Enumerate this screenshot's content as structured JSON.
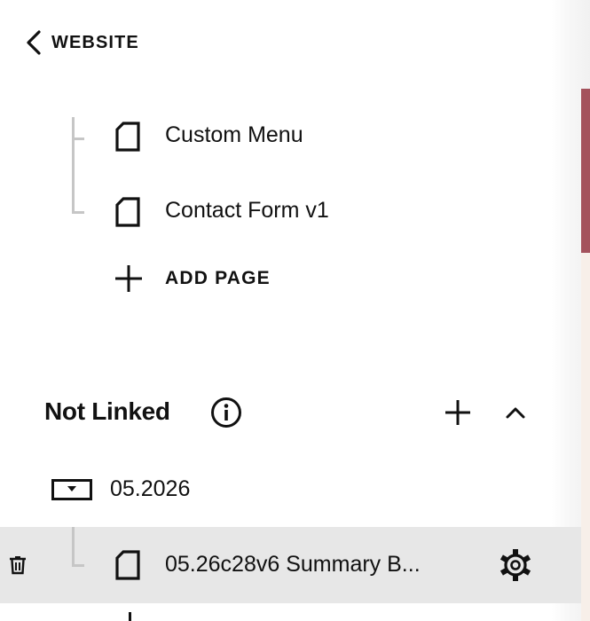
{
  "nav": {
    "back_label": "WEBSITE"
  },
  "pages": [
    {
      "label": "Custom Menu"
    },
    {
      "label": "Contact Form v1"
    }
  ],
  "add_page_label": "ADD PAGE",
  "not_linked": {
    "title": "Not Linked",
    "folder_label": "05.2026",
    "selected_item_label": "05.26c28v6 Summary B..."
  },
  "colors": {
    "text": "#111111",
    "tree_line": "#c6c6c6",
    "selected_row": "#e7e7e7",
    "accent_scroll": "#a4525c",
    "preview_bg": "#f7efe9"
  },
  "icons": {
    "back": "chevron-left-icon",
    "page": "page-icon",
    "add": "plus-icon",
    "info": "info-icon",
    "collapse": "chevron-up-icon",
    "folder": "folder-dropdown-icon",
    "delete": "trash-icon",
    "settings": "gear-icon"
  }
}
